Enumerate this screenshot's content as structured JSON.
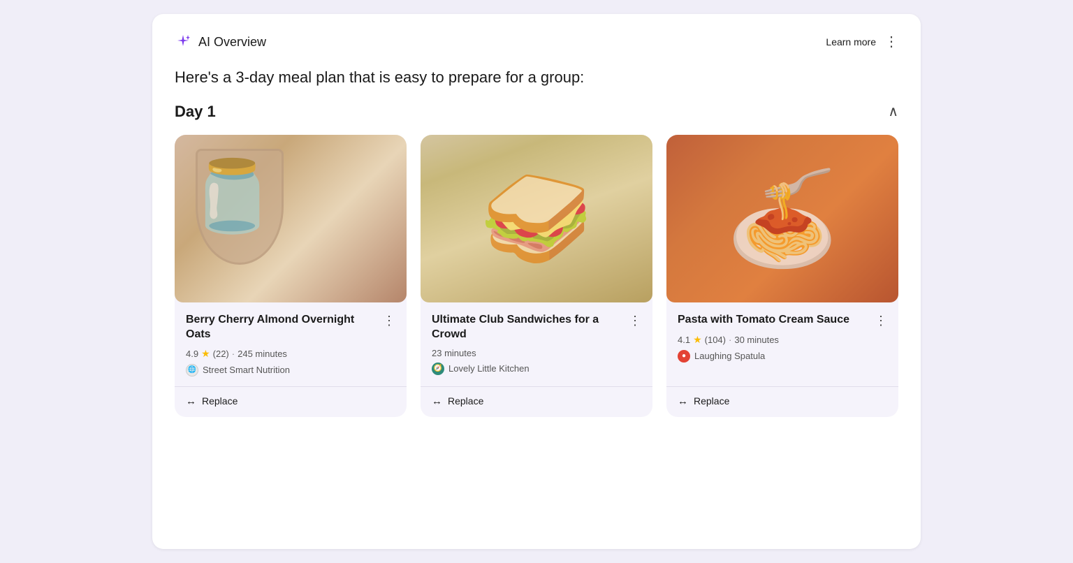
{
  "header": {
    "ai_label": "AI Overview",
    "learn_more": "Learn more",
    "ai_icon_label": "ai-sparkle-icon"
  },
  "intro": {
    "text": "Here's a 3-day meal plan that is easy to prepare for a group:"
  },
  "day": {
    "title": "Day 1"
  },
  "cards": [
    {
      "id": "card-1",
      "title": "Berry Cherry Almond Overnight Oats",
      "rating": "4.9",
      "review_count": "(22)",
      "time": "245 minutes",
      "source": "Street Smart Nutrition",
      "source_type": "ssn",
      "image_type": "oats",
      "replace_label": "Replace"
    },
    {
      "id": "card-2",
      "title": "Ultimate Club Sandwiches for a Crowd",
      "rating": null,
      "review_count": null,
      "time": "23 minutes",
      "source": "Lovely Little Kitchen",
      "source_type": "llk",
      "image_type": "sandwich",
      "replace_label": "Replace"
    },
    {
      "id": "card-3",
      "title": "Pasta with Tomato Cream Sauce",
      "rating": "4.1",
      "review_count": "(104)",
      "time": "30 minutes",
      "source": "Laughing Spatula",
      "source_type": "ls",
      "image_type": "pasta",
      "replace_label": "Replace"
    }
  ]
}
